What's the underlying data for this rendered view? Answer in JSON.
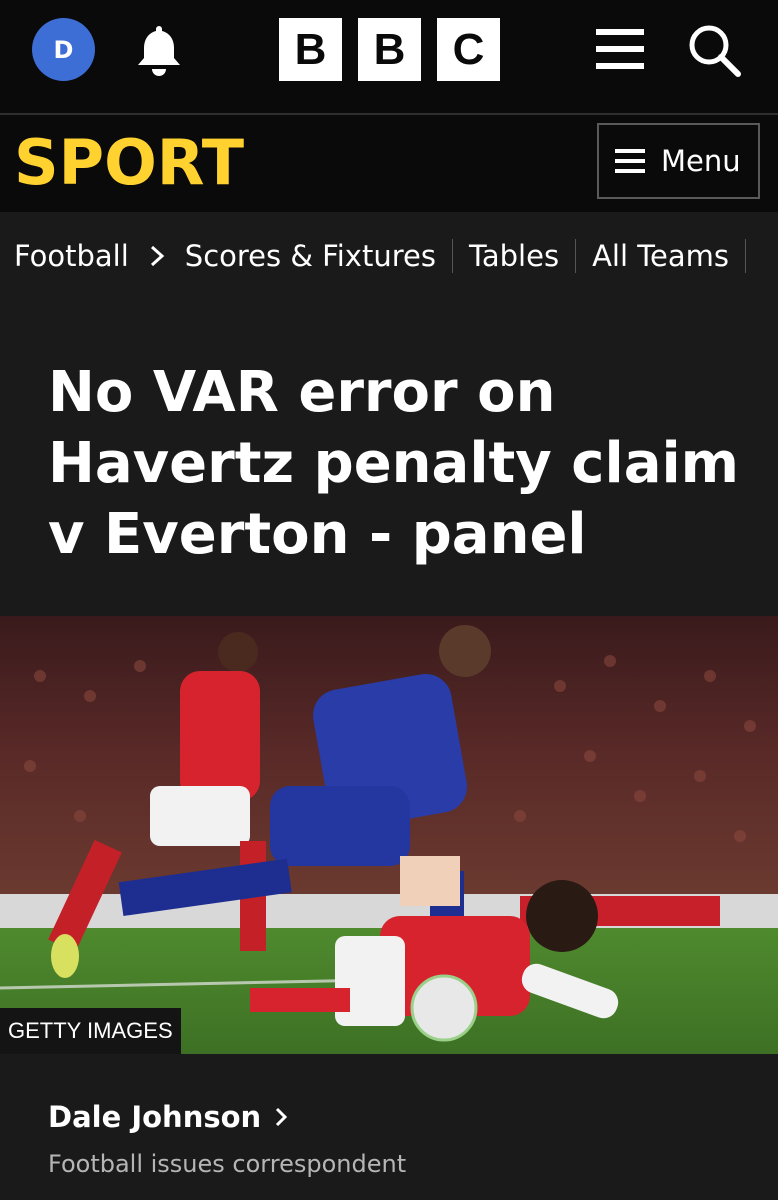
{
  "header": {
    "avatar_initial": "D",
    "logo_letters": [
      "B",
      "B",
      "C"
    ],
    "icons": [
      "bell-icon",
      "menu-icon",
      "search-icon"
    ]
  },
  "sport": {
    "title": "SPORT",
    "menu_label": "Menu"
  },
  "nav": {
    "section": "Football",
    "links": [
      "Scores & Fixtures",
      "Tables",
      "All Teams"
    ]
  },
  "article": {
    "headline": "No VAR error on Havertz penalty claim v Everton - panel",
    "image_credit": "GETTY IMAGES",
    "author_name": "Dale Johnson",
    "author_role": "Football issues correspondent"
  },
  "colors": {
    "sport_yellow": "#ffd230",
    "avatar_blue": "#3d6ed6",
    "background": "#1a1a1a"
  }
}
